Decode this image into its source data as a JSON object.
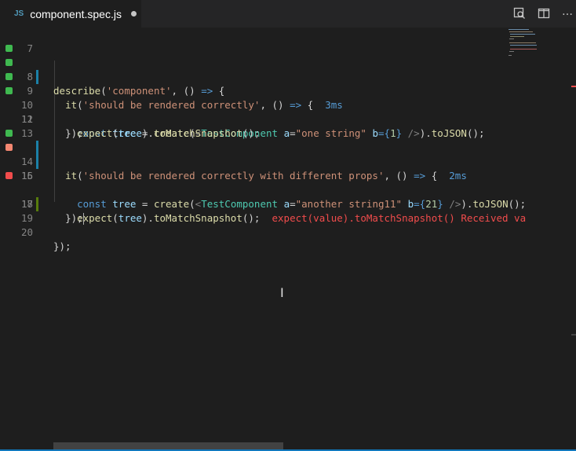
{
  "tab": {
    "language_badge": "JS",
    "filename": "component.spec.js",
    "modified": true
  },
  "toolbar": {
    "icons": [
      "open-preview-icon",
      "split-editor-icon",
      "more-actions-icon"
    ],
    "more_label": "…"
  },
  "editor": {
    "lines": [
      {
        "num": "7"
      },
      {
        "num": "8",
        "status": "pass"
      },
      {
        "num": "9",
        "status": "pass",
        "duration": "3ms"
      },
      {
        "num": "10",
        "status": "pass"
      },
      {
        "num": "11",
        "status": "pass"
      },
      {
        "num": "12"
      },
      {
        "num": "13"
      },
      {
        "num": "14",
        "status": "pass",
        "duration": "2ms"
      },
      {
        "num": "15",
        "status": "fail"
      },
      {
        "num": "16"
      },
      {
        "num": "17",
        "status": "fail",
        "error": "expect(value).toMatchSnapshot() Received va"
      },
      {
        "num": "18"
      },
      {
        "num": "19"
      },
      {
        "num": "20"
      }
    ],
    "code": {
      "l8_describe": "describe",
      "l8_name": "'component'",
      "l9_it": "it",
      "l9_name": "'should be rendered correctly'",
      "l10_const": "const",
      "l10_var": "tree",
      "l10_create": "create",
      "l10_tag": "TestComponent",
      "l10_attr_a": "a",
      "l10_str": "\"one string\"",
      "l10_attr_b": "b",
      "l10_num": "1",
      "l10_tojson": "toJSON",
      "l11_expect": "expect",
      "l11_var": "tree",
      "l11_match": "toMatchSnapshot",
      "l12_close": "});",
      "l14_it": "it",
      "l14_name": "'should be rendered correctly with different props'",
      "l15_const": "const",
      "l15_var": "tree",
      "l15_create": "create",
      "l15_tag": "TestComponent",
      "l15_attr_a": "a",
      "l15_str": "\"another string11\"",
      "l15_attr_b": "b",
      "l15_num": "21",
      "l15_tojson": "toJSON",
      "l17_expect": "expect",
      "l17_var": "tree",
      "l17_match": "toMatchSnapshot",
      "l18_close": "});",
      "l20_close": "});"
    }
  },
  "colors": {
    "pass": "#3fb950",
    "fail": "#f48771",
    "fail_strong": "#f14c4c",
    "accent": "#1177bb"
  }
}
